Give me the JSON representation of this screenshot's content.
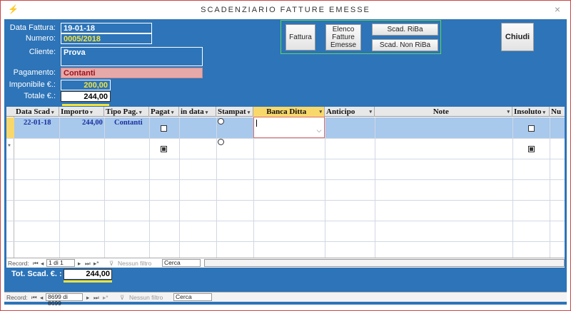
{
  "window": {
    "title": "SCADENZIARIO FATTURE EMESSE",
    "close_glyph": "×",
    "app_icon": "lightning-icon"
  },
  "header": {
    "data_fattura_label": "Data Fattura:",
    "data_fattura_value": "19-01-18",
    "numero_label": "Numero:",
    "numero_value": "0005/2018",
    "cliente_label": "Cliente:",
    "cliente_value": "Prova",
    "pagamento_label": "Pagamento:",
    "pagamento_value": "Contanti",
    "imponibile_label": "Imponibile €.:",
    "imponibile_value": "200,00",
    "totale_label": "Totale €.:",
    "totale_value": "244,00"
  },
  "buttons": {
    "fattura": "Fattura",
    "elenco_line1": "Elenco",
    "elenco_line2": "Fatture",
    "elenco_line3": "Emesse",
    "scad_riba": "Scad. RiBa",
    "scad_non_riba": "Scad. Non RiBa",
    "chiudi": "Chiudi"
  },
  "grid": {
    "columns": [
      "Data Scad",
      "Importo",
      "Tipo Pag.",
      "Pagat",
      "in data",
      "Stampat",
      "Banca Ditta",
      "Anticipo",
      "Note",
      "Insoluto",
      "Nu"
    ],
    "active_column": "Banca Ditta",
    "row1": {
      "data_scad": "22-01-18",
      "importo": "244,00",
      "tipo_pag": "Contanti"
    },
    "new_row_marker": "*"
  },
  "grid_nav": {
    "record_label": "Record:",
    "position": "1 di 1",
    "filter_label": "Nessun filtro",
    "search_placeholder": "Cerca"
  },
  "totals": {
    "tot_scad_label": "Tot. Scad. €. :",
    "tot_scad_value": "244,00"
  },
  "form_nav": {
    "record_label": "Record:",
    "position": "8699 di 8699",
    "filter_label": "Nessun filtro",
    "search_placeholder": "Cerca"
  },
  "colors": {
    "form_bg": "#2d74b8",
    "active_column": "#f9d86b",
    "selected_row": "#a8c8ec",
    "imponibile_text": "#f3e33a",
    "pagamento_bg": "#e6a9a9",
    "numero_bg": "#2b6fb0"
  }
}
